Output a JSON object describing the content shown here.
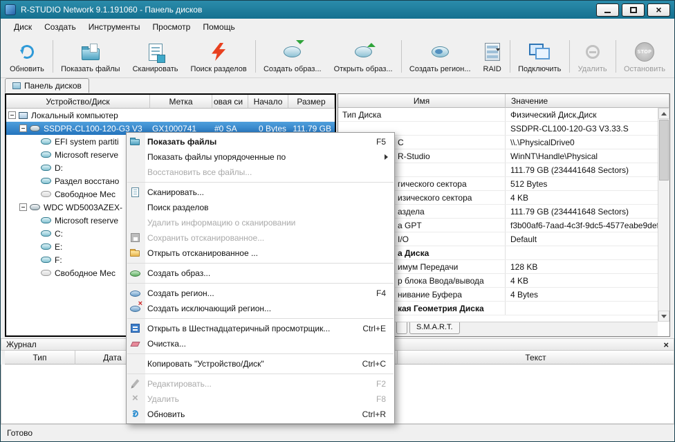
{
  "window": {
    "title": "R-STUDIO Network 9.1.191060 - Панель дисков",
    "status": "Готово"
  },
  "colors": {
    "titlebar": "#1e7f9f",
    "selection": "#2e7bc0",
    "toolbar_bg": "#f0f0f0"
  },
  "menu_bar": {
    "items": [
      {
        "label": "Диск"
      },
      {
        "label": "Создать"
      },
      {
        "label": "Инструменты"
      },
      {
        "label": "Просмотр"
      },
      {
        "label": "Помощь"
      }
    ]
  },
  "toolbar": {
    "items": [
      {
        "label": "Обновить",
        "icon": "refresh-icon"
      },
      {
        "label": "Показать файлы",
        "icon": "show-files-icon"
      },
      {
        "label": "Сканировать",
        "icon": "scan-icon"
      },
      {
        "label": "Поиск разделов",
        "icon": "search-partitions-icon"
      },
      {
        "label": "Создать образ...",
        "icon": "create-image-icon"
      },
      {
        "label": "Открыть образ...",
        "icon": "open-image-icon"
      },
      {
        "label": "Создать регион...",
        "icon": "create-region-icon"
      },
      {
        "label": "RAID",
        "icon": "raid-icon",
        "has_dropdown": true
      },
      {
        "label": "Подключить",
        "icon": "connect-icon"
      },
      {
        "label": "Удалить",
        "icon": "delete-icon",
        "disabled": true
      },
      {
        "label": "Остановить",
        "icon": "stop-icon",
        "icon_text": "STOP",
        "disabled": true
      }
    ]
  },
  "tab_bar": {
    "tabs": [
      {
        "label": "Панель дисков"
      }
    ]
  },
  "device_panel": {
    "columns": [
      "Устройство/Диск",
      "Метка",
      "овая си",
      "Начало",
      "Размер"
    ],
    "rows": [
      {
        "label": "Локальный компьютер",
        "level": 0,
        "icon": "computer",
        "expanded": true
      },
      {
        "label": "SSDPR-CL100-120-G3 V3",
        "metka": "GX1000741",
        "fs": "#0 SA",
        "start": "0 Bytes",
        "size": "111.79 GB",
        "level": 1,
        "icon": "disk",
        "expanded": true,
        "selected": true
      },
      {
        "label": "EFI system partiti",
        "level": 2,
        "icon": "partition"
      },
      {
        "label": "Microsoft reserve",
        "level": 2,
        "icon": "partition"
      },
      {
        "label": "D:",
        "level": 2,
        "icon": "partition"
      },
      {
        "label": "Раздел восстано",
        "level": 2,
        "icon": "partition"
      },
      {
        "label": "Свободное Мес",
        "level": 2,
        "icon": "free-space"
      },
      {
        "label": "WDC WD5003AZEX-",
        "level": 1,
        "icon": "disk",
        "expanded": true
      },
      {
        "label": "Microsoft reserve",
        "level": 2,
        "icon": "partition"
      },
      {
        "label": "C:",
        "level": 2,
        "icon": "partition"
      },
      {
        "label": "E:",
        "level": 2,
        "icon": "partition"
      },
      {
        "label": "F:",
        "level": 2,
        "icon": "partition"
      },
      {
        "label": "Свободное Мес",
        "level": 2,
        "icon": "free-space"
      }
    ]
  },
  "properties_panel": {
    "columns": [
      "Имя",
      "Значение"
    ],
    "rows": [
      {
        "name": "Тип Диска",
        "value": "Физический Диск,Диск"
      },
      {
        "name": "",
        "value": "SSDPR-CL100-120-G3 V3.33.S"
      },
      {
        "name": "С",
        "value": "\\\\.\\PhysicalDrive0",
        "frag": true
      },
      {
        "name": "R-Studio",
        "value": "WinNT\\Handle\\Physical",
        "frag": true
      },
      {
        "name": "",
        "value": "111.79 GB (234441648 Sectors)"
      },
      {
        "name": "гического сектора",
        "value": "512 Bytes",
        "frag": true
      },
      {
        "name": "изического сектора",
        "value": "4 KB",
        "frag": true
      },
      {
        "name": "аздела",
        "value": "111.79 GB (234441648 Sectors)",
        "frag": true
      },
      {
        "name": "а GPT",
        "value": "f3b00af6-7aad-4c3f-9dc5-4577eabe9def",
        "frag": true
      },
      {
        "name": "I/O",
        "value": "Default",
        "frag": true,
        "combo": true
      },
      {
        "name": "а Диска",
        "value": "",
        "frag": true,
        "section": true
      },
      {
        "name": "имум Передачи",
        "value": "128 KB",
        "frag": true,
        "combo": true
      },
      {
        "name": "р блока Ввода/вывода",
        "value": "4 KB",
        "frag": true,
        "combo": true
      },
      {
        "name": "нивание Буфера",
        "value": "4 Bytes",
        "frag": true,
        "combo": true
      },
      {
        "name": "кая Геометрия Диска",
        "value": "",
        "frag": true,
        "section": true
      }
    ],
    "tabs": [
      "",
      "S.M.A.R.T."
    ]
  },
  "context_menu": {
    "items": [
      {
        "label": "Показать файлы",
        "shortcut": "F5",
        "bold": true
      },
      {
        "label": "Показать файлы упорядоченные по",
        "submenu": true
      },
      {
        "label": "Восстановить все файлы...",
        "disabled": true
      },
      {
        "label": "Сканировать..."
      },
      {
        "label": "Поиск разделов"
      },
      {
        "label": "Удалить информацию о сканировании",
        "disabled": true
      },
      {
        "label": "Сохранить отсканированное...",
        "disabled": true
      },
      {
        "label": "Открыть отсканированное ..."
      },
      {
        "label": "Создать образ..."
      },
      {
        "label": "Создать регион...",
        "shortcut": "F4"
      },
      {
        "label": "Создать исключающий регион..."
      },
      {
        "label": "Открыть в Шестнадцатеричный просмотрщик...",
        "shortcut": "Ctrl+E"
      },
      {
        "label": "Очистка..."
      },
      {
        "label": "Копировать \"Устройство/Диск\"",
        "shortcut": "Ctrl+C"
      },
      {
        "label": "Редактировать...",
        "shortcut": "F2",
        "disabled": true
      },
      {
        "label": "Удалить",
        "shortcut": "F8",
        "disabled": true
      },
      {
        "label": "Обновить",
        "shortcut": "Ctrl+R"
      }
    ]
  },
  "log_panel": {
    "title": "Журнал",
    "columns": [
      "Тип",
      "Дата",
      "",
      "Текст"
    ]
  }
}
